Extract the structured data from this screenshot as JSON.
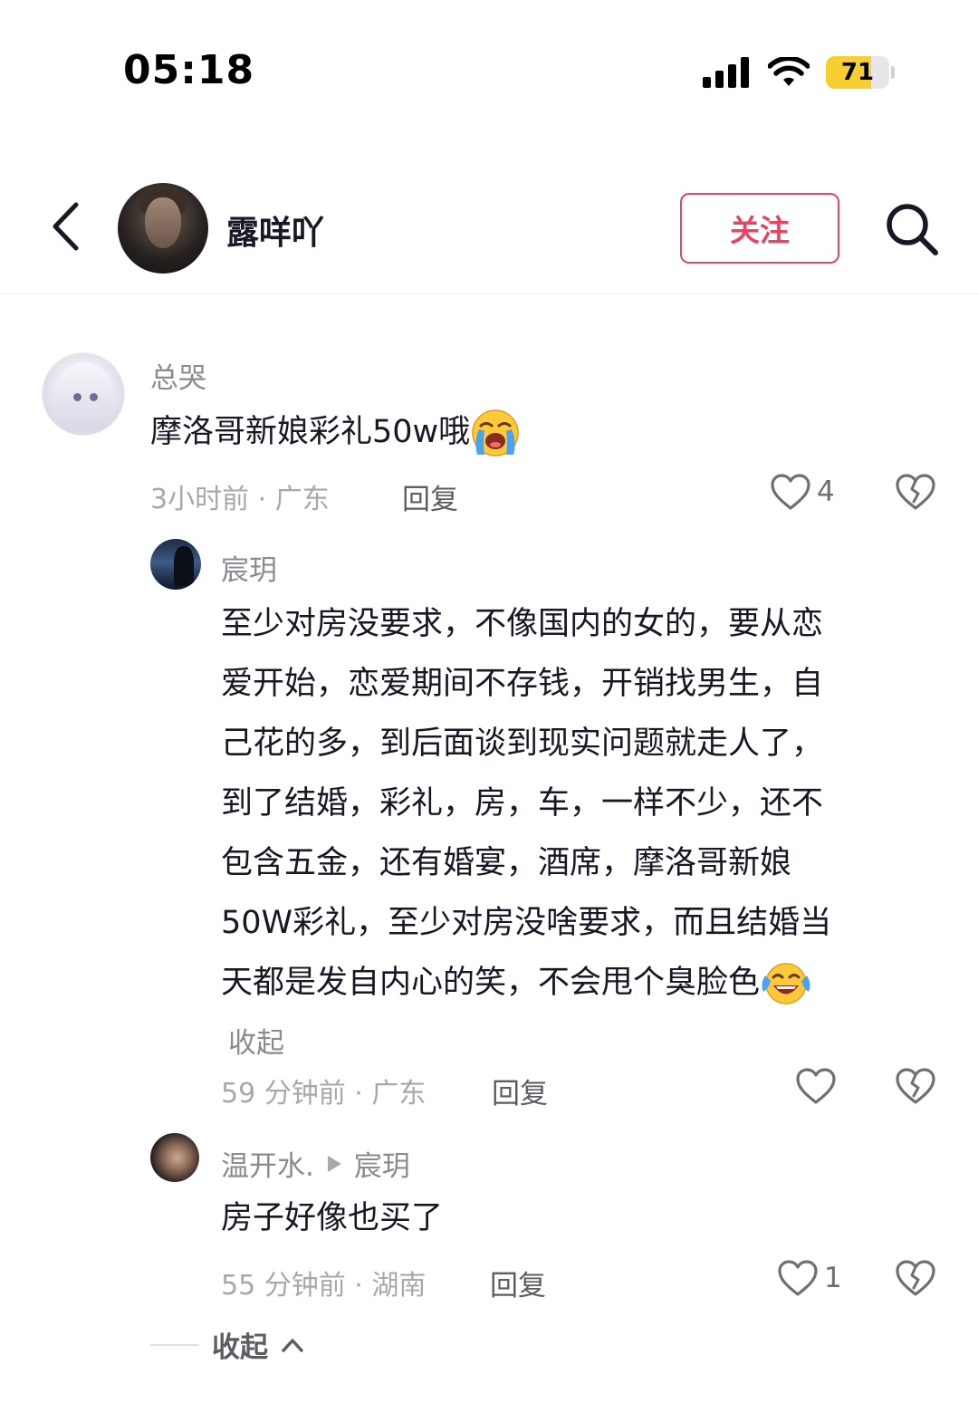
{
  "status_bar": {
    "time": "05:18",
    "battery": 71,
    "battery_label": "71",
    "battery_color": "#f7cf2e",
    "icons": [
      "signal-icon",
      "wifi-icon",
      "battery-icon"
    ]
  },
  "header": {
    "name": "露咩吖",
    "follow_label": "关注",
    "accent": "#e8435f"
  },
  "comment": {
    "username": "总哭",
    "text": "摩洛哥新娘彩礼50w哦",
    "emoji": "loudly-crying-face",
    "meta": "3小时前 · 广东",
    "reply_label": "回复",
    "likes": "4"
  },
  "replies": [
    {
      "username": "宸玥",
      "lines": [
        "至少对房没要求，不像国内的女的，要从恋",
        "爱开始，恋爱期间不存钱，开销找男生，自",
        "己花的多，到后面谈到现实问题就走人了，",
        "到了结婚，彩礼，房，车，一样不少，还不",
        "包含五金，还有婚宴，酒席，摩洛哥新娘",
        "50W彩礼，至少对房没啥要求，而且结婚当",
        "天都是发自内心的笑，不会甩个臭脸色"
      ],
      "emoji": "face-with-tears-of-joy",
      "collapse_label": "收起",
      "meta": "59 分钟前 · 广东",
      "reply_label": "回复"
    },
    {
      "username": "温开水.",
      "reply_to": "宸玥",
      "text": "房子好像也买了",
      "meta": "55 分钟前 · 湖南",
      "reply_label": "回复",
      "likes": "1"
    }
  ],
  "collapse_thread_label": "收起"
}
